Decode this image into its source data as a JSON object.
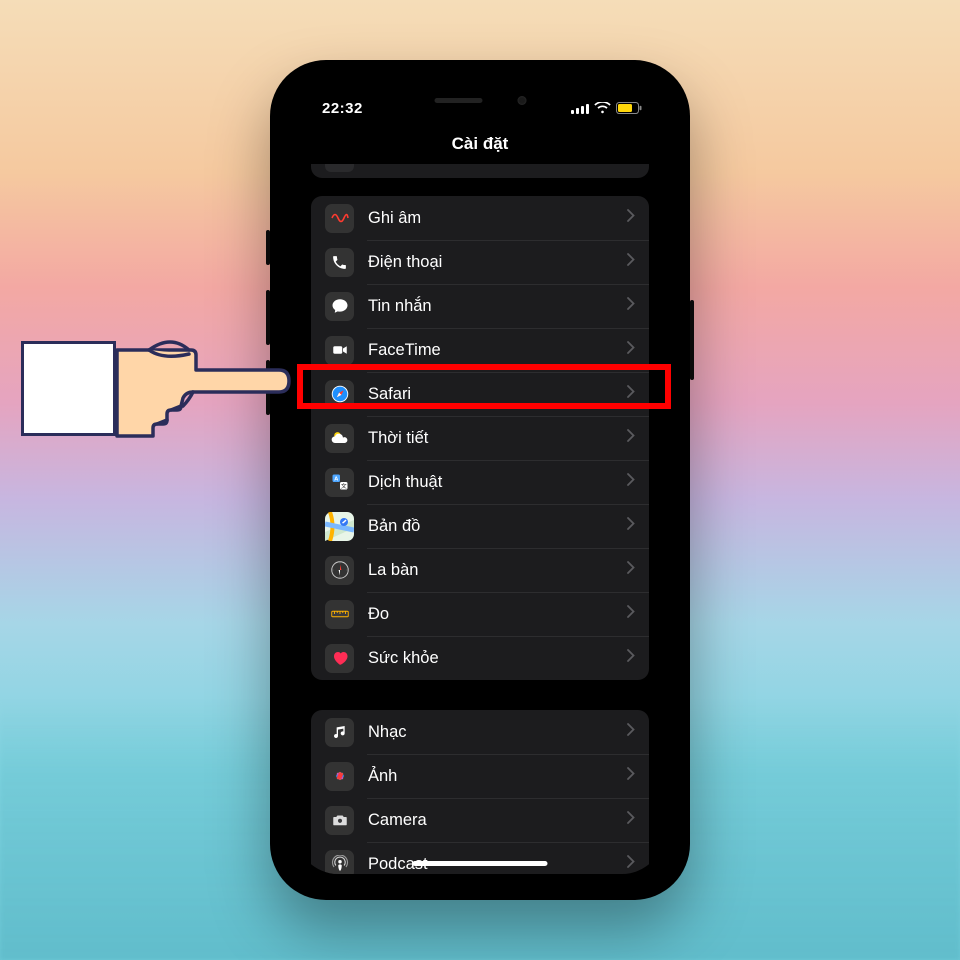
{
  "status": {
    "time": "22:32"
  },
  "header": {
    "title": "Cài đặt"
  },
  "groups": [
    {
      "items": [
        {
          "label": "Ghi âm",
          "icon": "voicememo-icon"
        },
        {
          "label": "Điện thoại",
          "icon": "phone-icon"
        },
        {
          "label": "Tin nhắn",
          "icon": "messages-icon"
        },
        {
          "label": "FaceTime",
          "icon": "facetime-icon"
        },
        {
          "label": "Safari",
          "icon": "safari-icon",
          "highlighted": true
        },
        {
          "label": "Thời tiết",
          "icon": "weather-icon"
        },
        {
          "label": "Dịch thuật",
          "icon": "translate-icon"
        },
        {
          "label": "Bản đồ",
          "icon": "maps-icon"
        },
        {
          "label": "La bàn",
          "icon": "compass-icon"
        },
        {
          "label": "Đo",
          "icon": "measure-icon"
        },
        {
          "label": "Sức khỏe",
          "icon": "health-icon"
        }
      ]
    },
    {
      "items": [
        {
          "label": "Nhạc",
          "icon": "music-icon"
        },
        {
          "label": "Ảnh",
          "icon": "photos-icon"
        },
        {
          "label": "Camera",
          "icon": "camera-icon"
        },
        {
          "label": "Podcast",
          "icon": "podcast-icon"
        }
      ]
    }
  ],
  "annotation": {
    "highlight_color": "#ff0000",
    "pointer": "hand-pointing-right"
  }
}
